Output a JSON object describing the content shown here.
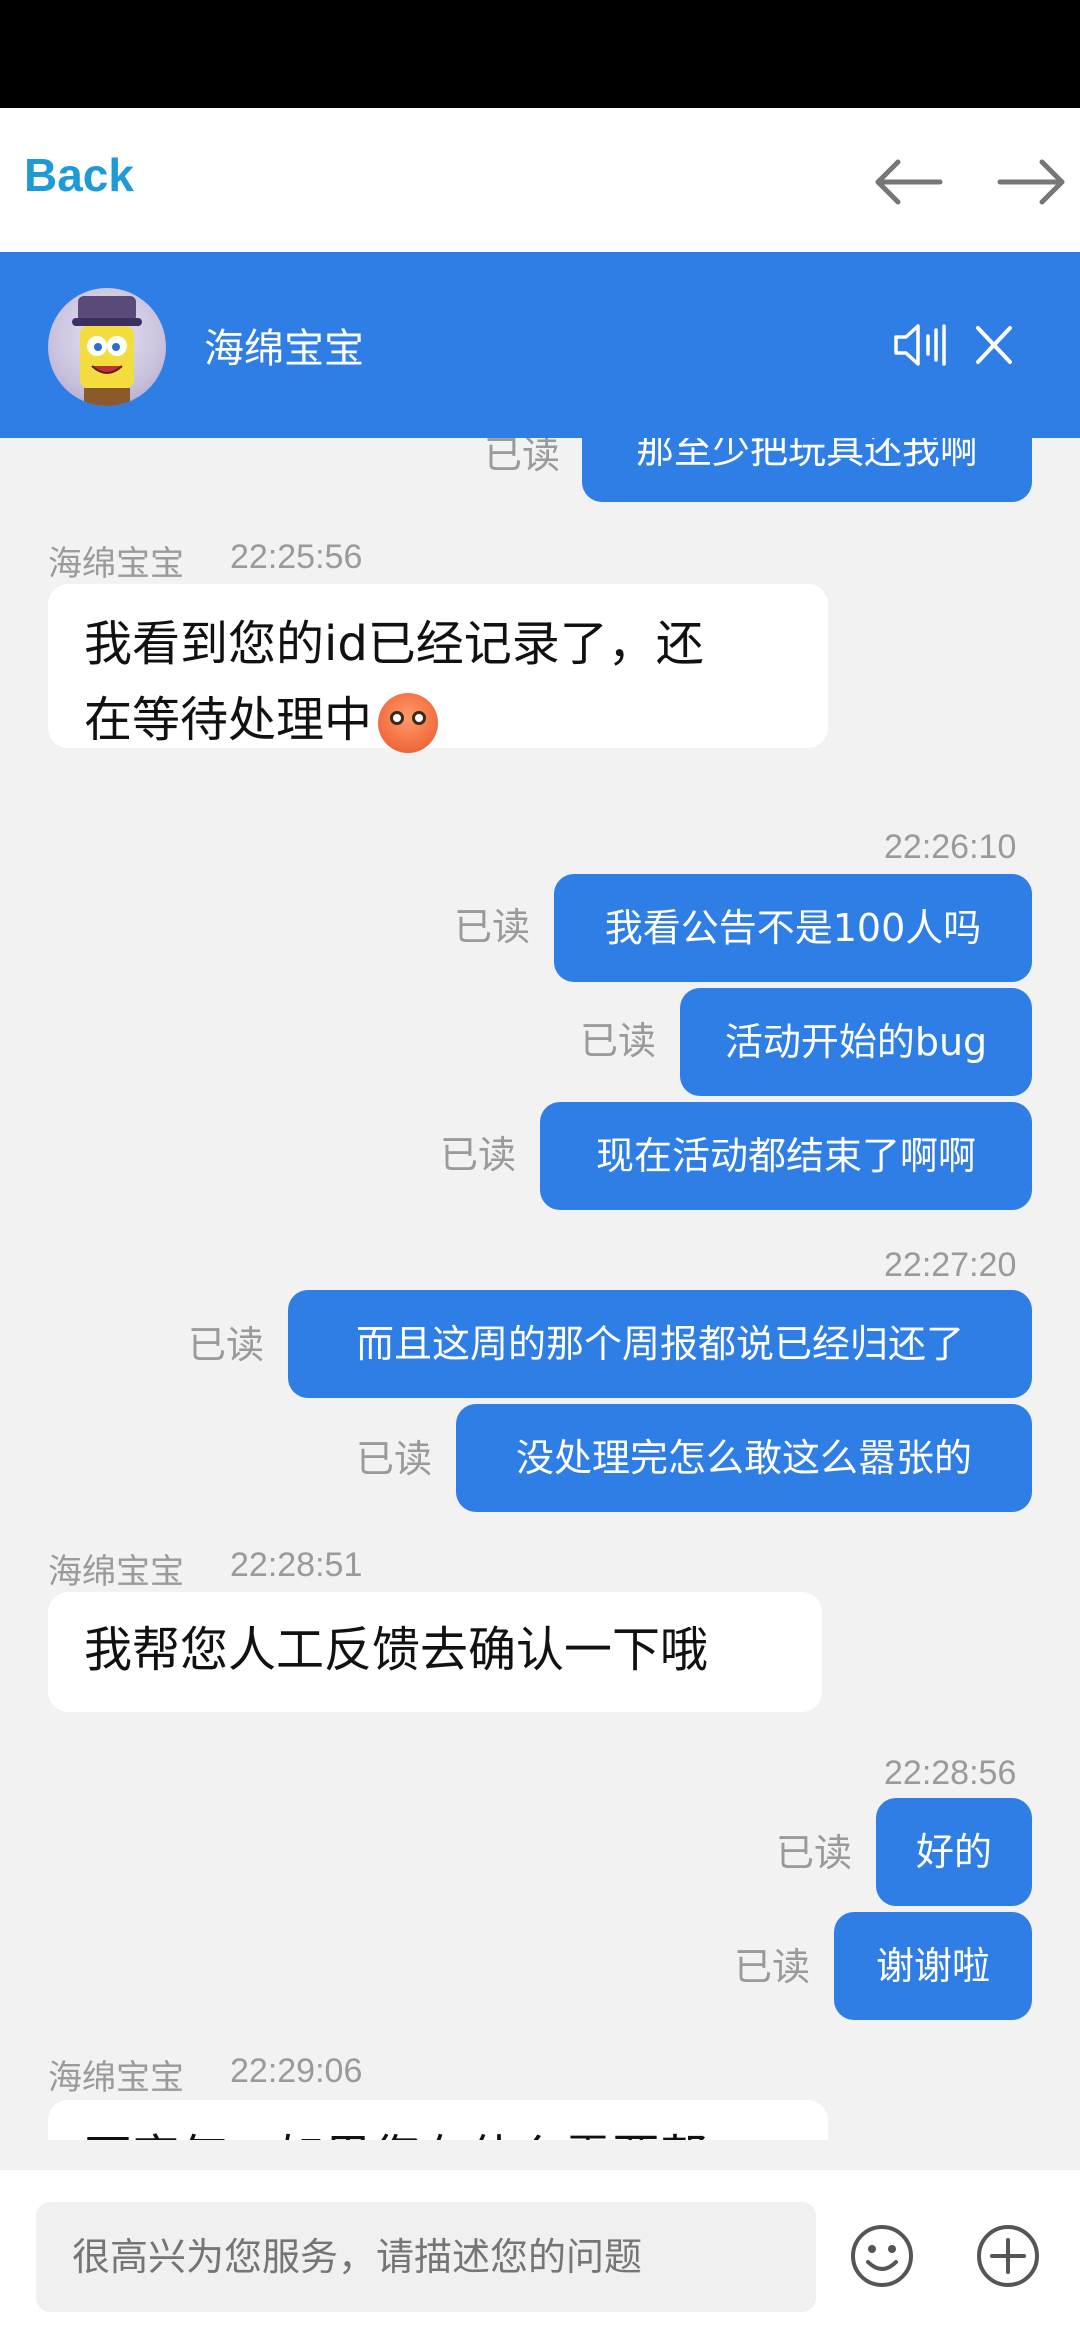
{
  "nav": {
    "back_label": "Back"
  },
  "header": {
    "contact_name": "海绵宝宝"
  },
  "messages": {
    "partial_top": {
      "read": "已读",
      "text": "那至少把玩具还我啊"
    },
    "g1": {
      "sender": "海绵宝宝",
      "time": "22:25:56",
      "line1": "我看到您的id已经记录了，还",
      "line2": "在等待处理中"
    },
    "g2": {
      "time": "22:26:10",
      "items": [
        {
          "read": "已读",
          "text": "我看公告不是100人吗"
        },
        {
          "read": "已读",
          "text": "活动开始的bug"
        },
        {
          "read": "已读",
          "text": "现在活动都结束了啊啊"
        }
      ]
    },
    "g3": {
      "time": "22:27:20",
      "items": [
        {
          "read": "已读",
          "text": "而且这周的那个周报都说已经归还了"
        },
        {
          "read": "已读",
          "text": "没处理完怎么敢这么嚣张的"
        }
      ]
    },
    "g4": {
      "sender": "海绵宝宝",
      "time": "22:28:51",
      "text": "我帮您人工反馈去确认一下哦"
    },
    "g5": {
      "time": "22:28:56",
      "items": [
        {
          "read": "已读",
          "text": "好的"
        },
        {
          "read": "已读",
          "text": "谢谢啦"
        }
      ]
    },
    "g6": {
      "sender": "海绵宝宝",
      "time": "22:29:06",
      "text_partial": "不客气，如果您有什么需要帮"
    }
  },
  "input": {
    "placeholder": "很高兴为您服务，请描述您的问题"
  },
  "icons": {
    "back_arrow": "arrow-left-icon",
    "forward_arrow": "arrow-right-icon",
    "speaker": "speaker-icon",
    "close": "close-icon",
    "emoji": "smiley-icon",
    "add": "plus-circle-icon"
  },
  "colors": {
    "accent": "#2e7ee6",
    "back_link": "#1e9bd7",
    "background": "#f2f2f2"
  }
}
